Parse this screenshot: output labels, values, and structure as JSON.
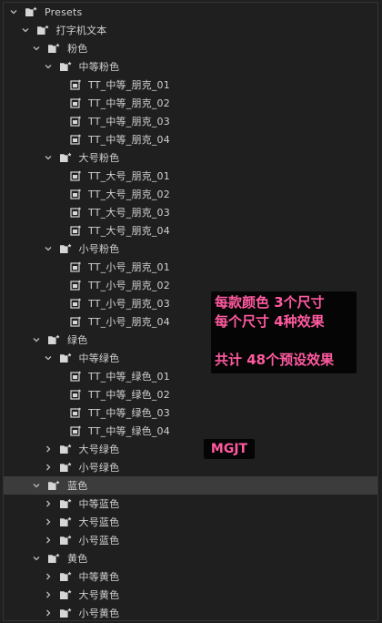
{
  "panel": {
    "tree": [
      {
        "label": "Presets",
        "type": "folder",
        "depth": 0,
        "state": "expanded"
      },
      {
        "label": "打字机文本",
        "type": "folder",
        "depth": 1,
        "state": "expanded"
      },
      {
        "label": "粉色",
        "type": "folder",
        "depth": 2,
        "state": "expanded"
      },
      {
        "label": "中等粉色",
        "type": "folder",
        "depth": 3,
        "state": "expanded"
      },
      {
        "label": "TT_中等_朋克_01",
        "type": "preset",
        "depth": 4
      },
      {
        "label": "TT_中等_朋克_02",
        "type": "preset",
        "depth": 4
      },
      {
        "label": "TT_中等_朋克_03",
        "type": "preset",
        "depth": 4
      },
      {
        "label": "TT_中等_朋克_04",
        "type": "preset",
        "depth": 4
      },
      {
        "label": "大号粉色",
        "type": "folder",
        "depth": 3,
        "state": "expanded"
      },
      {
        "label": "TT_大号_朋克_01",
        "type": "preset",
        "depth": 4
      },
      {
        "label": "TT_大号_朋克_02",
        "type": "preset",
        "depth": 4
      },
      {
        "label": "TT_大号_朋克_03",
        "type": "preset",
        "depth": 4
      },
      {
        "label": "TT_大号_朋克_04",
        "type": "preset",
        "depth": 4
      },
      {
        "label": "小号粉色",
        "type": "folder",
        "depth": 3,
        "state": "expanded"
      },
      {
        "label": "TT_小号_朋克_01",
        "type": "preset",
        "depth": 4
      },
      {
        "label": "TT_小号_朋克_02",
        "type": "preset",
        "depth": 4
      },
      {
        "label": "TT_小号_朋克_03",
        "type": "preset",
        "depth": 4
      },
      {
        "label": "TT_小号_朋克_04",
        "type": "preset",
        "depth": 4
      },
      {
        "label": "绿色",
        "type": "folder",
        "depth": 2,
        "state": "expanded"
      },
      {
        "label": "中等绿色",
        "type": "folder",
        "depth": 3,
        "state": "expanded"
      },
      {
        "label": "TT_中等_绿色_01",
        "type": "preset",
        "depth": 4
      },
      {
        "label": "TT_中等_绿色_02",
        "type": "preset",
        "depth": 4
      },
      {
        "label": "TT_中等_绿色_03",
        "type": "preset",
        "depth": 4
      },
      {
        "label": "TT_中等_绿色_04",
        "type": "preset",
        "depth": 4
      },
      {
        "label": "大号绿色",
        "type": "folder",
        "depth": 3,
        "state": "collapsed"
      },
      {
        "label": "小号绿色",
        "type": "folder",
        "depth": 3,
        "state": "collapsed"
      },
      {
        "label": "蓝色",
        "type": "folder",
        "depth": 2,
        "state": "expanded",
        "selected": true
      },
      {
        "label": "中等蓝色",
        "type": "folder",
        "depth": 3,
        "state": "collapsed"
      },
      {
        "label": "大号蓝色",
        "type": "folder",
        "depth": 3,
        "state": "collapsed"
      },
      {
        "label": "小号蓝色",
        "type": "folder",
        "depth": 3,
        "state": "collapsed"
      },
      {
        "label": "黄色",
        "type": "folder",
        "depth": 2,
        "state": "expanded"
      },
      {
        "label": "中等黄色",
        "type": "folder",
        "depth": 3,
        "state": "collapsed"
      },
      {
        "label": "大号黄色",
        "type": "folder",
        "depth": 3,
        "state": "collapsed"
      },
      {
        "label": "小号黄色",
        "type": "folder",
        "depth": 3,
        "state": "collapsed"
      }
    ]
  },
  "overlays": {
    "info_lines": [
      "每款颜色 3个尺寸",
      "每个尺寸 4种效果",
      "",
      "共计 48个预设效果"
    ],
    "watermark": "MGJT"
  },
  "colors": {
    "overlay_text": "#ff5aa0",
    "overlay_bg": "#050505",
    "selected_row": "#3c3c3c"
  }
}
